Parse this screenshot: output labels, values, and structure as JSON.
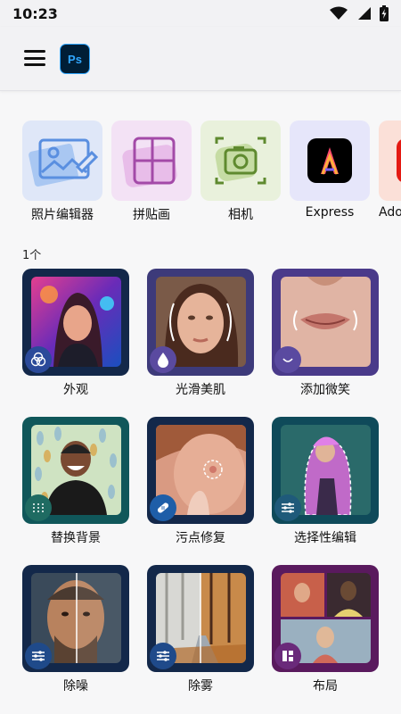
{
  "status_bar": {
    "time": "10:23"
  },
  "app_bar": {
    "logo_text": "Ps"
  },
  "apps": [
    {
      "label": "照片编辑器",
      "icon": "photo-edit-icon"
    },
    {
      "label": "拼贴画",
      "icon": "collage-icon"
    },
    {
      "label": "相机",
      "icon": "camera-icon"
    },
    {
      "label": "Express",
      "icon": "adobe-express-icon"
    },
    {
      "label": "Ado",
      "icon": "adobe-icon"
    }
  ],
  "section": {
    "title": "1个"
  },
  "tools": [
    {
      "label": "外观",
      "badge_icon": "looks-icon"
    },
    {
      "label": "光滑美肌",
      "badge_icon": "drop-icon"
    },
    {
      "label": "添加微笑",
      "badge_icon": "smile-icon"
    },
    {
      "label": "替换背景",
      "badge_icon": "background-icon"
    },
    {
      "label": "污点修复",
      "badge_icon": "bandage-icon"
    },
    {
      "label": "选择性编辑",
      "badge_icon": "sliders-icon"
    },
    {
      "label": "除噪",
      "badge_icon": "sliders-icon"
    },
    {
      "label": "除雾",
      "badge_icon": "sliders-icon"
    },
    {
      "label": "布局",
      "badge_icon": "layout-icon"
    }
  ],
  "colors": {
    "accent_blue": "#31a8ff",
    "frame_navy": "#13284a",
    "frame_purple": "#3d3a7a",
    "frame_teal": "#10575a",
    "frame_magenta": "#5a1a5e"
  }
}
